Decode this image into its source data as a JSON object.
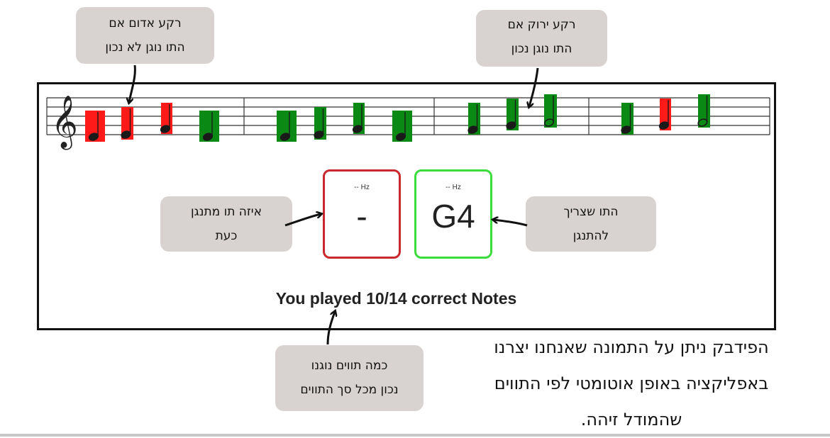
{
  "colors": {
    "correct": "#0a8a14",
    "incorrect": "#ff1a1a",
    "played_border": "#c9282e",
    "target_border": "#3ddc3d"
  },
  "icons": {
    "clef": "treble-clef-icon"
  },
  "clef_glyph": "𝄞",
  "notes": [
    {
      "status": "incorrect",
      "head": "filled"
    },
    {
      "status": "incorrect",
      "head": "filled"
    },
    {
      "status": "incorrect",
      "head": "filled"
    },
    {
      "status": "correct",
      "head": "filled"
    },
    {
      "status": "correct",
      "head": "filled"
    },
    {
      "status": "correct",
      "head": "filled"
    },
    {
      "status": "correct",
      "head": "filled"
    },
    {
      "status": "correct",
      "head": "filled"
    },
    {
      "status": "correct",
      "head": "filled"
    },
    {
      "status": "correct",
      "head": "filled"
    },
    {
      "status": "correct",
      "head": "open"
    },
    {
      "status": "correct",
      "head": "filled"
    },
    {
      "status": "incorrect",
      "head": "filled"
    },
    {
      "status": "correct",
      "head": "open"
    }
  ],
  "played": {
    "hz": "-- Hz",
    "note": "-"
  },
  "target": {
    "hz": "-- Hz",
    "note": "G4"
  },
  "score_text": "You played 10/14 correct Notes",
  "callouts": {
    "red": [
      "רקע אדום אם",
      "התו נוגן לא נכון"
    ],
    "green": [
      "רקע ירוק אם",
      "התו נוגן נכון"
    ],
    "current": [
      "איזה תו מתנגן",
      "כעת"
    ],
    "target": [
      "התו שצריך",
      "להתנגן"
    ],
    "count": [
      "כמה תווים נוגנו",
      "נכון מכל סך התווים"
    ]
  },
  "caption": [
    "הפידבק ניתן על התמונה שאנחנו יצרנו",
    "באפליקציה באופן אוטומטי לפי התווים",
    "שהמודל זיהה."
  ]
}
